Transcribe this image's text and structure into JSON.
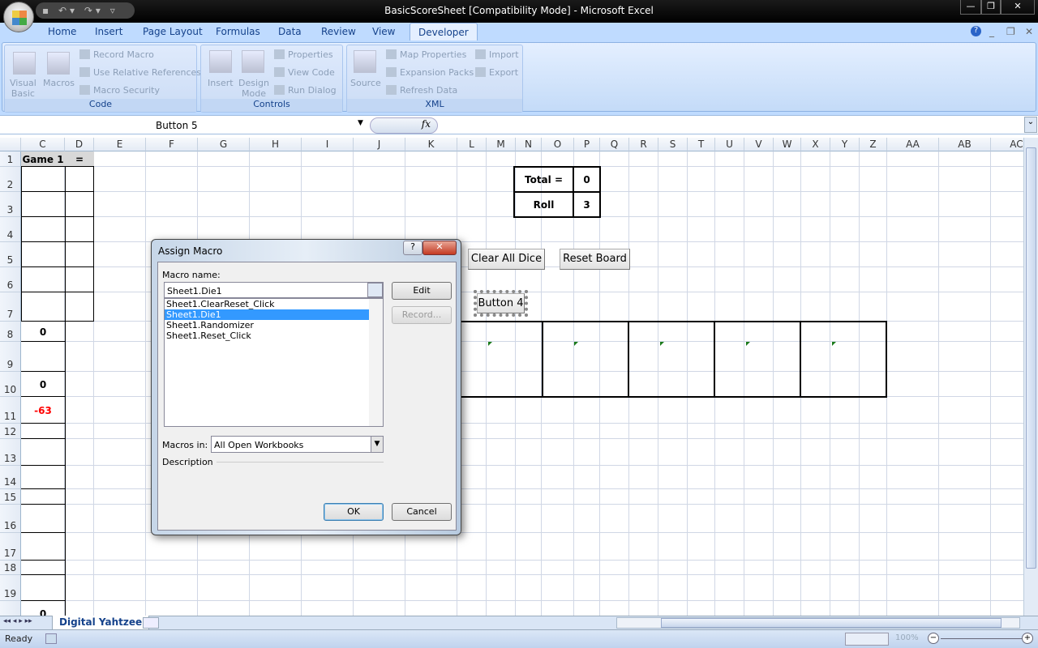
{
  "window": {
    "title": "BasicScoreSheet  [Compatibility Mode] - Microsoft Excel",
    "qat": "▪ ↶▾ ↷▾ ▿",
    "minimize": "—",
    "restore": "❐",
    "close": "✕"
  },
  "ribbon": {
    "tabs": [
      "Home",
      "Insert",
      "Page Layout",
      "Formulas",
      "Data",
      "Review",
      "View",
      "Developer"
    ],
    "active_tab": "Developer",
    "help": "?",
    "doc_min": "_",
    "doc_restore": "❐",
    "doc_close": "✕",
    "code": {
      "label": "Code",
      "visual_basic": "Visual\nBasic",
      "macros": "Macros",
      "record_macro": "Record Macro",
      "use_relative": "Use Relative References",
      "macro_security": "Macro Security"
    },
    "controls": {
      "label": "Controls",
      "insert": "Insert",
      "design_mode": "Design\nMode",
      "properties": "Properties",
      "view_code": "View Code",
      "run_dialog": "Run Dialog"
    },
    "xml": {
      "label": "XML",
      "source": "Source",
      "map_properties": "Map Properties",
      "expansion_packs": "Expansion Packs",
      "refresh_data": "Refresh Data",
      "import": "Import",
      "export": "Export"
    }
  },
  "formula_bar": {
    "name_box": "Button 5",
    "fx": "fx",
    "formula": ""
  },
  "grid": {
    "columns": [
      "C",
      "D",
      "E",
      "F",
      "G",
      "H",
      "I",
      "J",
      "K",
      "L",
      "M",
      "N",
      "O",
      "P",
      "Q",
      "R",
      "S",
      "T",
      "U",
      "V",
      "W",
      "X",
      "Y",
      "Z",
      "AA",
      "AB",
      "AC"
    ],
    "rows": [
      "1",
      "2",
      "3",
      "4",
      "5",
      "6",
      "7",
      "8",
      "9",
      "10",
      "11",
      "12",
      "13",
      "14",
      "15",
      "16",
      "17",
      "18",
      "19",
      "20"
    ],
    "c1": "Game 1",
    "d1": "=",
    "c8": "0",
    "c10": "0",
    "c11": "-63",
    "c20": "0",
    "total_label": "Total =",
    "total_value": "0",
    "roll_label": "Roll",
    "roll_value": "3",
    "clear_all_dice": "Clear All Dice",
    "reset_board": "Reset Board",
    "button4": "Button 4"
  },
  "dialog": {
    "title": "Assign Macro",
    "help": "?",
    "close": "✕",
    "macro_name_label": "Macro name:",
    "macro_name_value": "Sheet1.Die1",
    "macros": [
      "Sheet1.ClearReset_Click",
      "Sheet1.Die1",
      "Sheet1.Randomizer",
      "Sheet1.Reset_Click"
    ],
    "selected_index": 1,
    "edit": "Edit",
    "record": "Record...",
    "macros_in_label": "Macros in:",
    "macros_in_value": "All Open Workbooks",
    "description_label": "Description",
    "ok": "OK",
    "cancel": "Cancel"
  },
  "sheet_tabs": {
    "active": "Digital Yahtzee",
    "nav": "◂◂ ◂ ▸ ▸▸"
  },
  "status": {
    "ready": "Ready",
    "zoom": "100%"
  },
  "colors": {
    "selection": "#3399ff",
    "negative": "#ff0000",
    "accent": "#15428b"
  }
}
